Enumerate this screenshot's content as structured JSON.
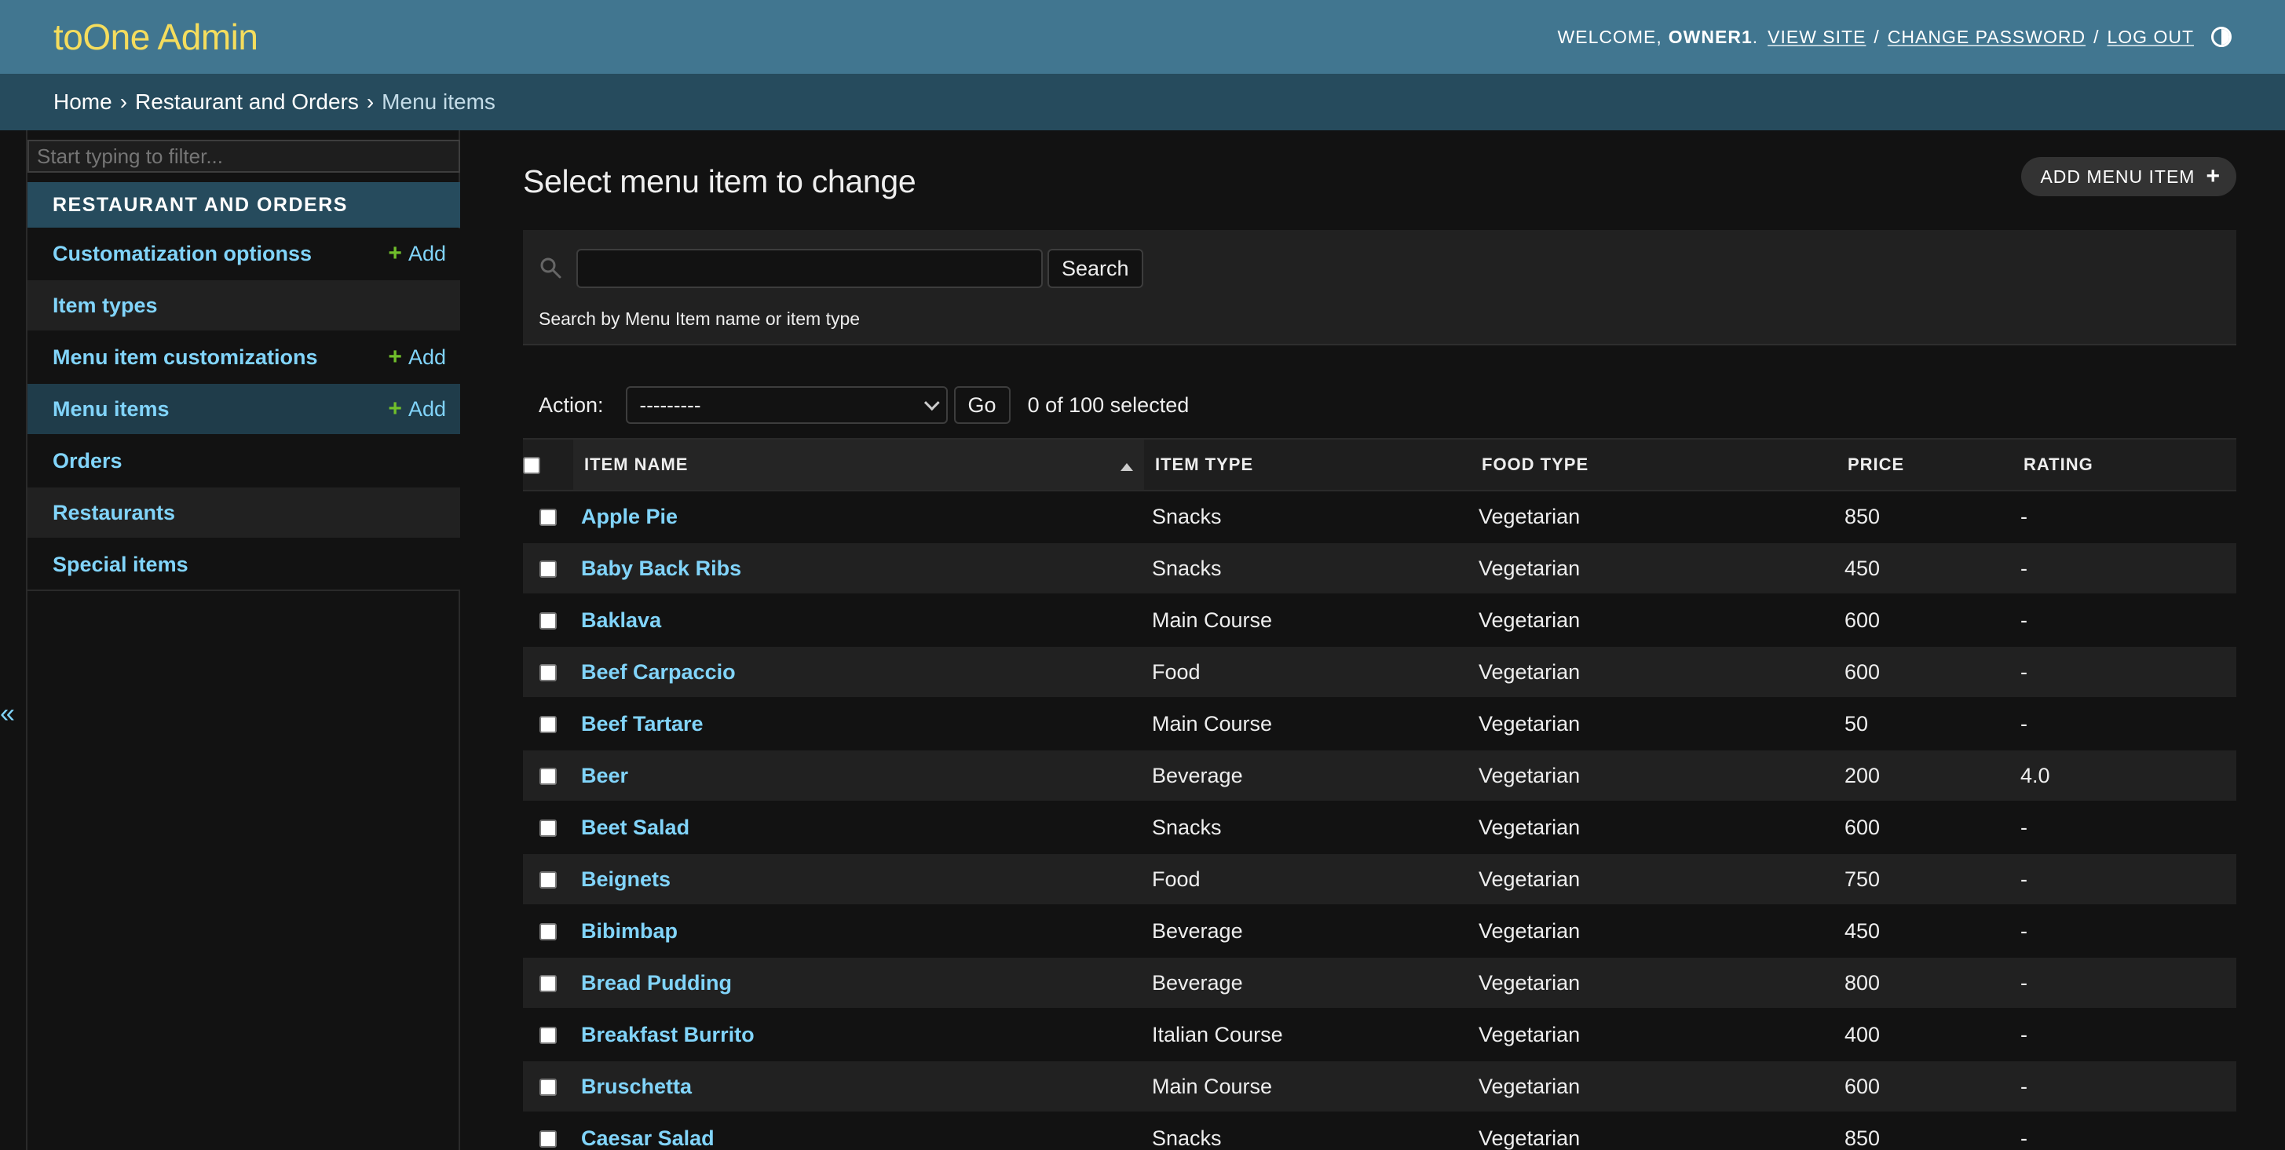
{
  "header": {
    "branding": "toOne Admin",
    "welcome": "WELCOME,",
    "username": "OWNER1",
    "view_site": "VIEW SITE",
    "change_password": "CHANGE PASSWORD",
    "log_out": "LOG OUT"
  },
  "breadcrumbs": [
    "Home",
    "Restaurant and Orders",
    "Menu items"
  ],
  "sidebar": {
    "filter_placeholder": "Start typing to filter...",
    "app_caption": "RESTAURANT AND ORDERS",
    "add_label": "Add",
    "items": [
      {
        "label": "Customatization optionss",
        "has_add": true
      },
      {
        "label": "Item types",
        "has_add": false
      },
      {
        "label": "Menu item customizations",
        "has_add": true
      },
      {
        "label": "Menu items",
        "has_add": true,
        "active": true
      },
      {
        "label": "Orders",
        "has_add": false
      },
      {
        "label": "Restaurants",
        "has_add": false
      },
      {
        "label": "Special items",
        "has_add": false
      }
    ],
    "collapse_glyph": "«"
  },
  "content": {
    "title": "Select menu item to change",
    "add_button": "ADD MENU ITEM",
    "search_button": "Search",
    "search_help": "Search by Menu Item name or item type",
    "action_label": "Action:",
    "action_selected": "---------",
    "go_button": "Go",
    "selection_count": "0 of 100 selected"
  },
  "table": {
    "columns": [
      "ITEM NAME",
      "ITEM TYPE",
      "FOOD TYPE",
      "PRICE",
      "RATING"
    ],
    "rows": [
      [
        "Apple Pie",
        "Snacks",
        "Vegetarian",
        "850",
        "-"
      ],
      [
        "Baby Back Ribs",
        "Snacks",
        "Vegetarian",
        "450",
        "-"
      ],
      [
        "Baklava",
        "Main Course",
        "Vegetarian",
        "600",
        "-"
      ],
      [
        "Beef Carpaccio",
        "Food",
        "Vegetarian",
        "600",
        "-"
      ],
      [
        "Beef Tartare",
        "Main Course",
        "Vegetarian",
        "50",
        "-"
      ],
      [
        "Beer",
        "Beverage",
        "Vegetarian",
        "200",
        "4.0"
      ],
      [
        "Beet Salad",
        "Snacks",
        "Vegetarian",
        "600",
        "-"
      ],
      [
        "Beignets",
        "Food",
        "Vegetarian",
        "750",
        "-"
      ],
      [
        "Bibimbap",
        "Beverage",
        "Vegetarian",
        "450",
        "-"
      ],
      [
        "Bread Pudding",
        "Beverage",
        "Vegetarian",
        "800",
        "-"
      ],
      [
        "Breakfast Burrito",
        "Italian Course",
        "Vegetarian",
        "400",
        "-"
      ],
      [
        "Bruschetta",
        "Main Course",
        "Vegetarian",
        "600",
        "-"
      ],
      [
        "Caesar Salad",
        "Snacks",
        "Vegetarian",
        "850",
        "-"
      ]
    ]
  },
  "colors": {
    "header_bg": "#417690",
    "breadcrumb_bg": "#264b5d",
    "branding": "#f5dd5d",
    "link": "#81d4fa",
    "add_plus": "#70bf2b",
    "page_bg": "#121212"
  }
}
